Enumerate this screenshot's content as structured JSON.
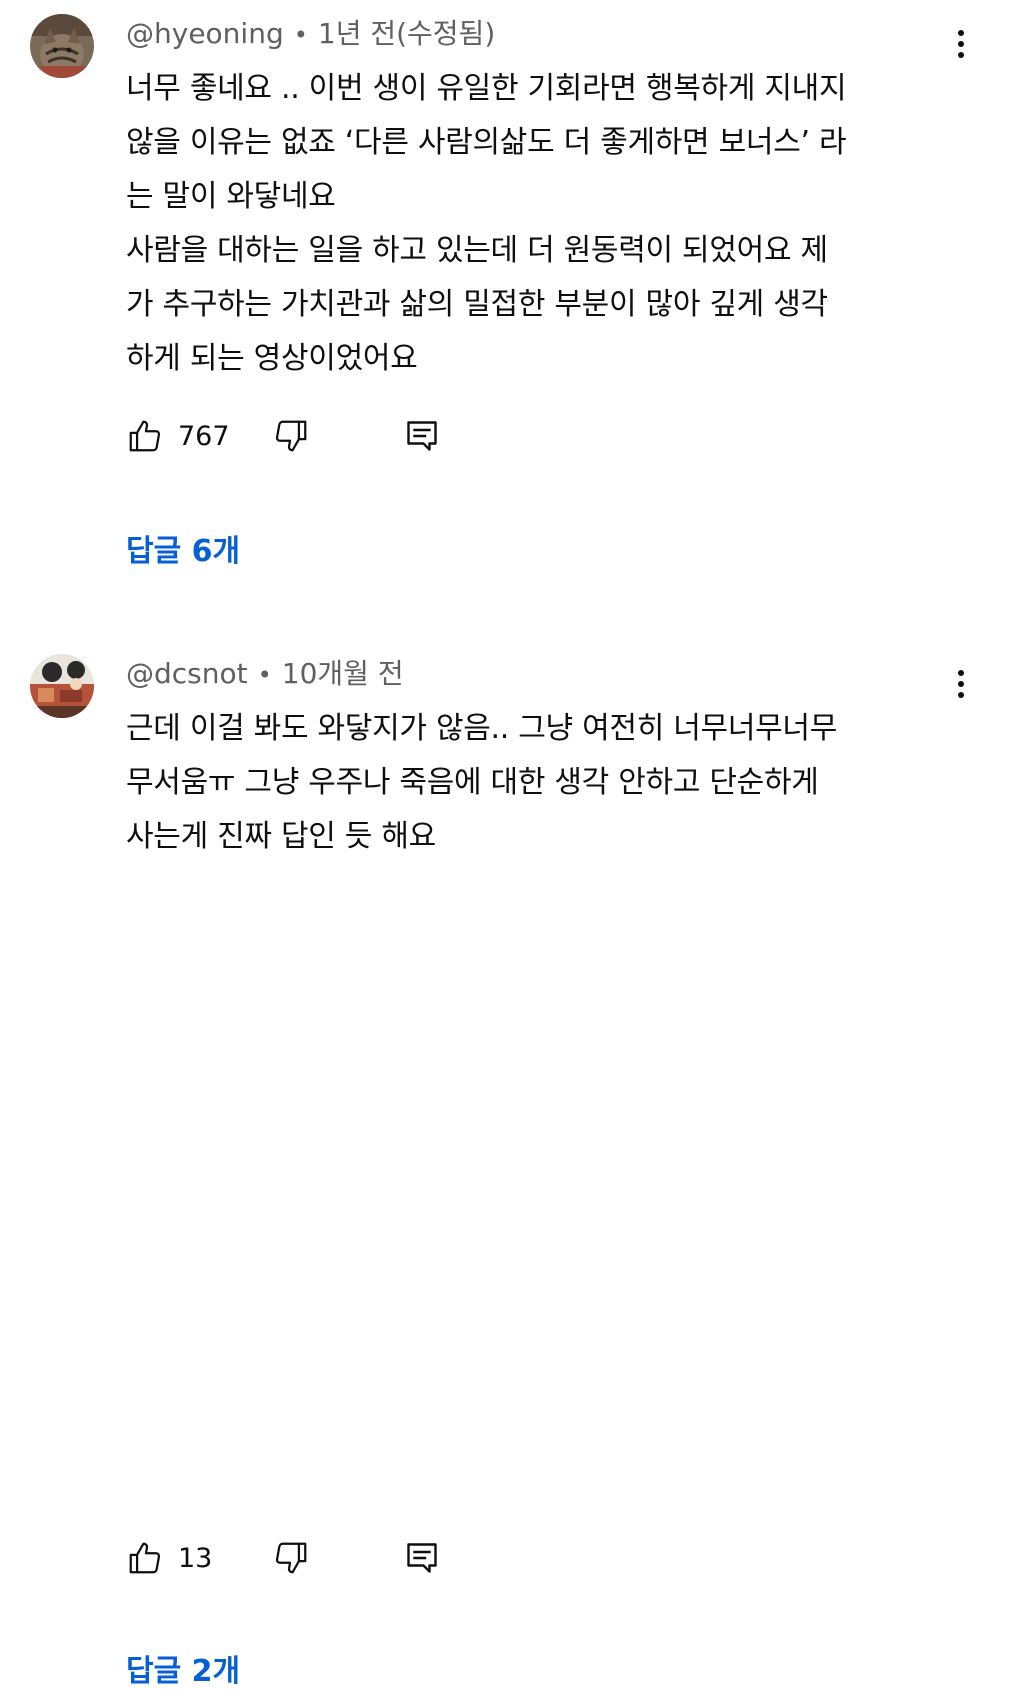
{
  "comments": [
    {
      "author": "@hyeoning",
      "time": "1년 전(수정됨)",
      "text": "너무 좋네요 .. 이번 생이 유일한 기회라면 행복하게 지내지\n않을 이유는 없죠 ‘다른 사람의삶도 더 좋게하면 보너스’ 라\n는 말이 와닿네요\n사람을 대하는 일을 하고 있는데 더 원동력이 되었어요 제\n가 추구하는 가치관과 삶의 밀접한 부분이 많아 깊게 생각\n하게 되는 영상이었어요",
      "likes": "767",
      "replies_label": "답글 6개"
    },
    {
      "author": "@dcsnot",
      "time": "10개월 전",
      "text": "근데 이걸 봐도 와닿지가 않음.. 그냥 여전히 너무너무너무\n무서움ㅠ 그냥 우주나 죽음에 대한 생각 안하고 단순하게\n사는게 진짜 답인 듯 해요",
      "likes": "13",
      "replies_label": "답글 2개"
    }
  ],
  "separator": "•",
  "icons": {
    "like": "thumbs-up-icon",
    "dislike": "thumbs-down-icon",
    "reply": "reply-comment-icon",
    "more": "more-vertical-icon"
  },
  "colors": {
    "link": "#065fd4",
    "meta": "#606060",
    "text": "#0f0f0f"
  }
}
